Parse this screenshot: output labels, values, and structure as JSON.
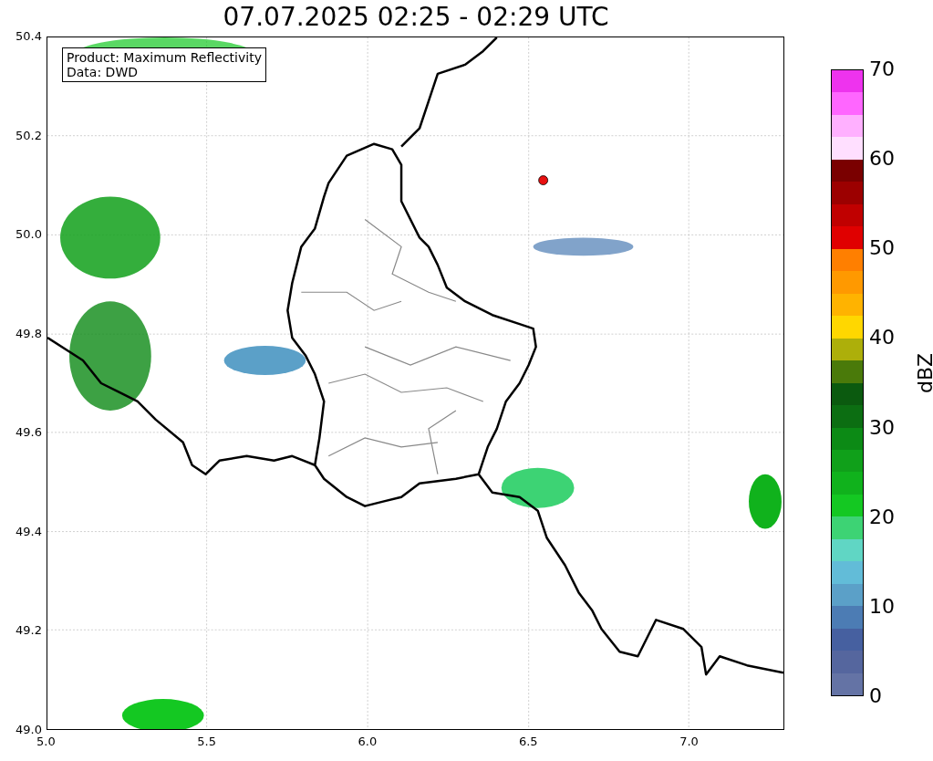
{
  "title": "07.07.2025 02:25 - 02:29 UTC",
  "map": {
    "legend": [
      "Product: Maximum Reflectivity",
      "Data: DWD"
    ],
    "x_ticks": [
      "5.0",
      "5.5",
      "6.0",
      "6.5",
      "7.0"
    ],
    "y_ticks": [
      "50.4",
      "50.2",
      "50.0",
      "49.8",
      "49.6",
      "49.4",
      "49.2",
      "49.0"
    ]
  },
  "colorbar": {
    "label": "dBZ",
    "ticks": [
      "70",
      "60",
      "50",
      "40",
      "30",
      "20",
      "10",
      "0"
    ],
    "bins": [
      {
        "color": "#ee33ee"
      },
      {
        "color": "#ff66ff"
      },
      {
        "color": "#ffb0ff"
      },
      {
        "color": "#ffdfff"
      },
      {
        "color": "#7a0000"
      },
      {
        "color": "#9c0000"
      },
      {
        "color": "#c00000"
      },
      {
        "color": "#e00000"
      },
      {
        "color": "#ff7f00"
      },
      {
        "color": "#ff9900"
      },
      {
        "color": "#ffb300"
      },
      {
        "color": "#ffd700"
      },
      {
        "color": "#adaf0a"
      },
      {
        "color": "#4a7a0a"
      },
      {
        "color": "#0b5a0f"
      },
      {
        "color": "#0c6e12"
      },
      {
        "color": "#0c8a15"
      },
      {
        "color": "#10a01a"
      },
      {
        "color": "#10b21c"
      },
      {
        "color": "#14c822"
      },
      {
        "color": "#3dd374"
      },
      {
        "color": "#60d6c4"
      },
      {
        "color": "#62bcd8"
      },
      {
        "color": "#5ba0c8"
      },
      {
        "color": "#4c7cb4"
      },
      {
        "color": "#4660a0"
      },
      {
        "color": "#55669e"
      },
      {
        "color": "#6473a5"
      }
    ]
  }
}
